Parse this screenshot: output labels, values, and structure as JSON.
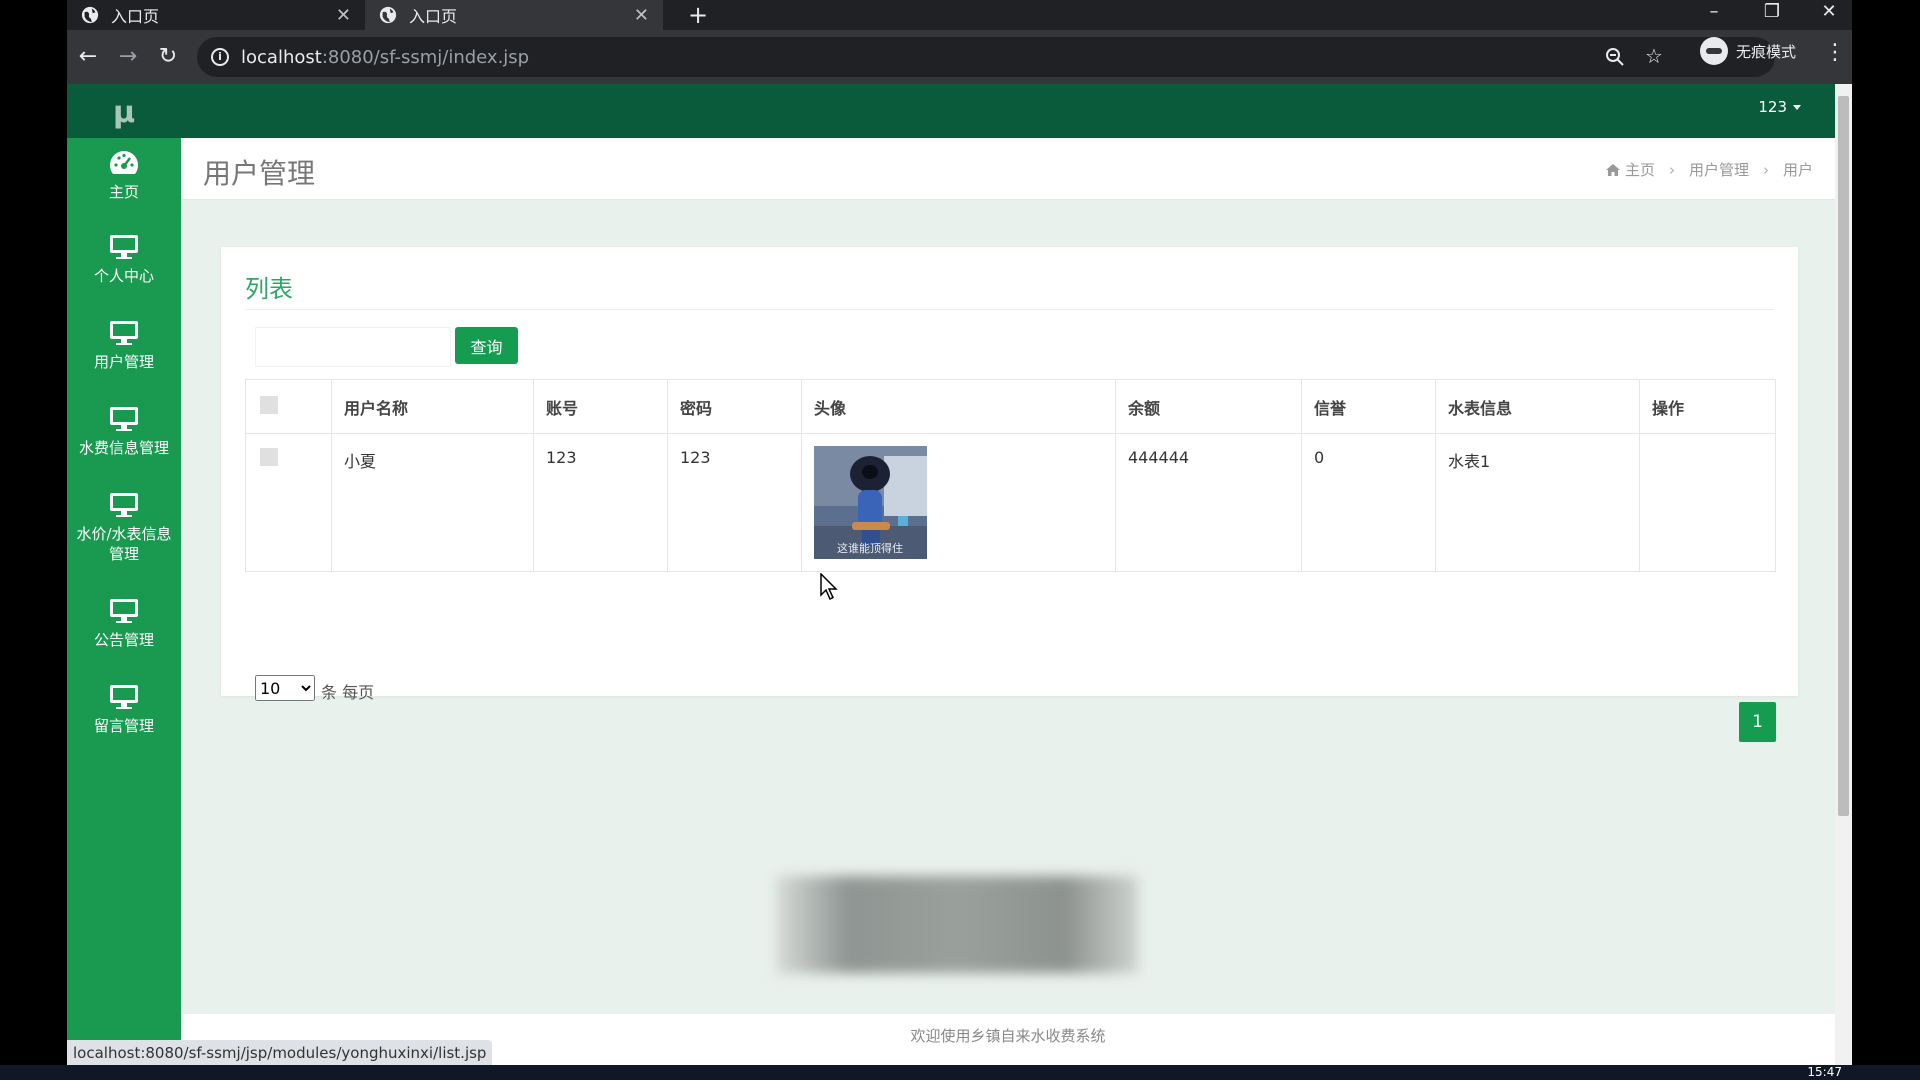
{
  "browser": {
    "tabs": [
      {
        "title": "入口页",
        "close": "✕"
      },
      {
        "title": "入口页",
        "close": "✕"
      }
    ],
    "new_tab": "+",
    "url_host": "localhost",
    "url_path": ":8080/sf-ssmj/index.jsp",
    "profile_label": "无痕模式",
    "status_url": "localhost:8080/sf-ssmj/jsp/modules/yonghuxinxi/list.jsp"
  },
  "app": {
    "logo": "μ",
    "user": "123",
    "sidebar": [
      {
        "label": "主页",
        "icon": "dashboard-icon"
      },
      {
        "label": "个人中心",
        "icon": "monitor-icon"
      },
      {
        "label": "用户管理",
        "icon": "monitor-icon"
      },
      {
        "label": "水费信息管理",
        "icon": "monitor-icon"
      },
      {
        "label": "水价/水表信息管理",
        "icon": "monitor-icon"
      },
      {
        "label": "公告管理",
        "icon": "monitor-icon"
      },
      {
        "label": "留言管理",
        "icon": "monitor-icon"
      }
    ]
  },
  "page": {
    "title": "用户管理",
    "breadcrumb": [
      "主页",
      "用户管理",
      "用户"
    ],
    "card_title": "列表",
    "search": {
      "value": "",
      "button": "查询"
    },
    "table": {
      "headers": [
        "用户名称",
        "账号",
        "密码",
        "头像",
        "余额",
        "信誉",
        "水表信息",
        "操作"
      ],
      "rows": [
        {
          "name": "小夏",
          "account": "123",
          "password": "123",
          "avatar_caption": "这谁能顶得住",
          "balance": "444444",
          "credit": "0",
          "meter": "水表1",
          "ops": ""
        }
      ]
    },
    "pagination": {
      "page_size": "10",
      "page_size_suffix": "条 每页",
      "current_page": "1"
    },
    "footer": "欢迎使用乡镇自来水收费系统"
  },
  "taskbar": {
    "clock": "15:47"
  },
  "colors": {
    "sidebar": "#1a9a50",
    "topbar": "#0a5b3b",
    "accent": "#169c50",
    "page_bg": "#e9f1ec"
  }
}
